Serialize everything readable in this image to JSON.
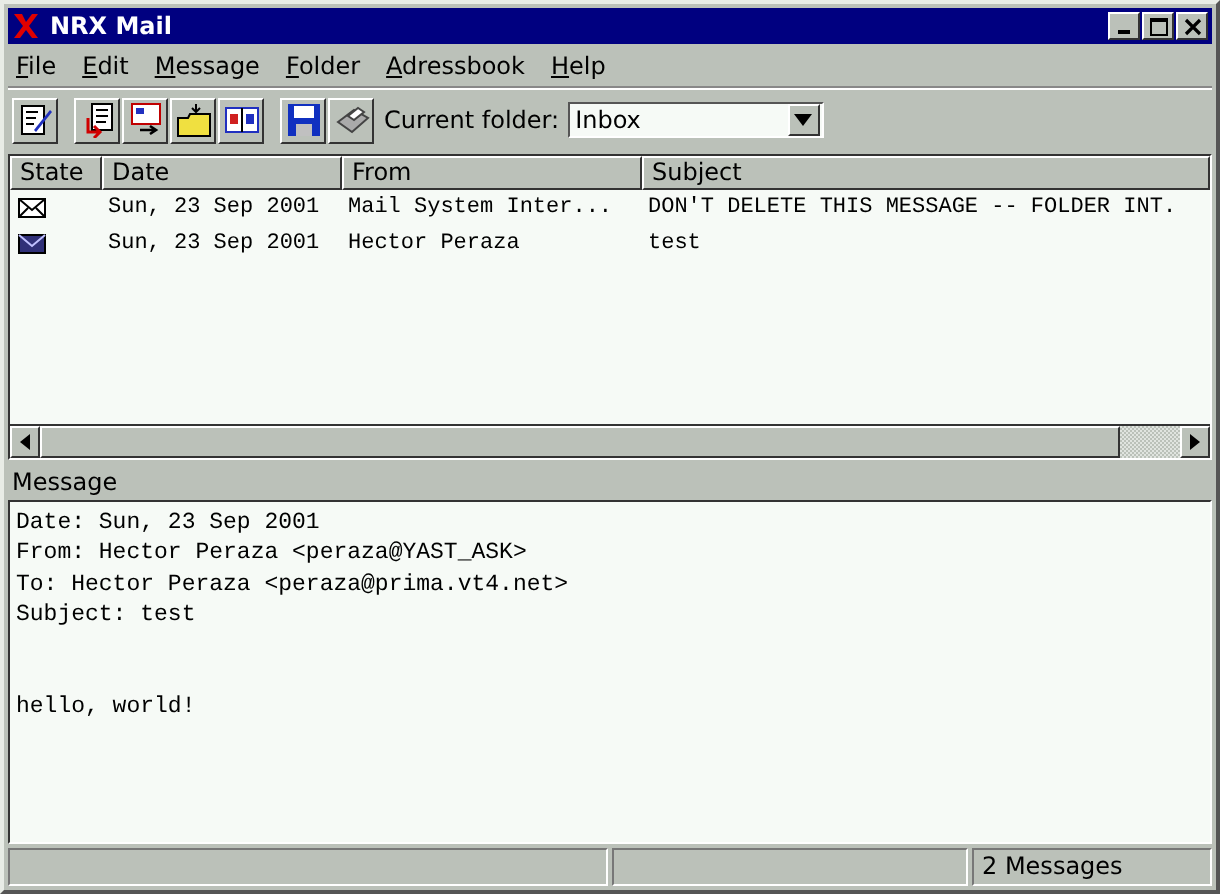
{
  "window": {
    "title": "NRX Mail"
  },
  "menu": [
    "File",
    "Edit",
    "Message",
    "Folder",
    "Adressbook",
    "Help"
  ],
  "toolbar": {
    "folder_label": "Current folder:",
    "folder_value": "Inbox"
  },
  "table": {
    "columns": [
      "State",
      "Date",
      "From",
      "Subject"
    ],
    "rows": [
      {
        "read": true,
        "date": "Sun, 23 Sep 2001",
        "from": "Mail System Inter...",
        "subject": "DON'T DELETE THIS MESSAGE -- FOLDER INT."
      },
      {
        "read": false,
        "date": "Sun, 23 Sep 2001",
        "from": "Hector Peraza",
        "subject": "test"
      }
    ]
  },
  "message": {
    "label": "Message",
    "headers": [
      "Date: Sun, 23 Sep 2001",
      "From: Hector Peraza <peraza@YAST_ASK>",
      "To: Hector Peraza <peraza@prima.vt4.net>",
      "Subject: test"
    ],
    "body": [
      "hello, world!"
    ]
  },
  "status_bar": {
    "count": "2 Messages"
  }
}
